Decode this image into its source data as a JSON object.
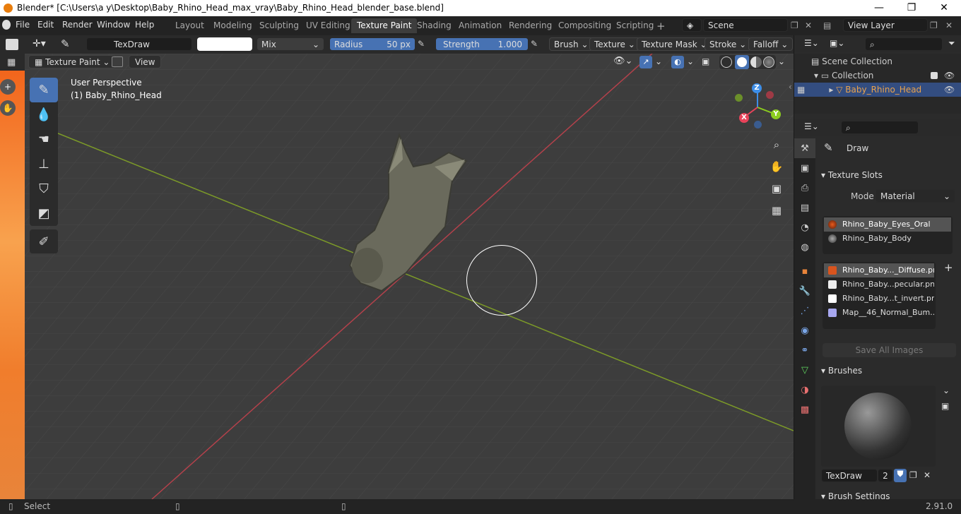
{
  "window": {
    "title": "Blender* [C:\\Users\\a y\\Desktop\\Baby_Rhino_Head_max_vray\\Baby_Rhino_Head_blender_base.blend]",
    "minimize": "—",
    "maximize": "❐",
    "close": "✕"
  },
  "menu": [
    "File",
    "Edit",
    "Render",
    "Window",
    "Help"
  ],
  "workspaces": [
    "Layout",
    "Modeling",
    "Sculpting",
    "UV Editing",
    "Texture Paint",
    "Shading",
    "Animation",
    "Rendering",
    "Compositing",
    "Scripting"
  ],
  "active_workspace": "Texture Paint",
  "scene": {
    "scene_name": "Scene",
    "view_layer": "View Layer"
  },
  "tool_header": {
    "brush_name": "TexDraw",
    "blend_mode": "Mix",
    "radius_label": "Radius",
    "radius_value": "50 px",
    "strength_label": "Strength",
    "strength_value": "1.000",
    "strength_fraction": 1.0,
    "menus": [
      "Brush",
      "Texture",
      "Texture Mask",
      "Stroke",
      "Falloff"
    ]
  },
  "viewport_header": {
    "mode": "Texture Paint",
    "view": "View"
  },
  "viewport": {
    "perspective": "User Perspective",
    "object": "(1) Baby_Rhino_Head"
  },
  "gizmo": {
    "x": "X",
    "y": "Y",
    "z": "Z"
  },
  "outliner": {
    "scene_collection": "Scene Collection",
    "collection": "Collection",
    "object": "Baby_Rhino_Head"
  },
  "properties": {
    "brush": "Draw",
    "texture_slots_title": "Texture Slots",
    "mode_label": "Mode",
    "mode_value": "Material",
    "materials": [
      "Rhino_Baby_Eyes_Oral",
      "Rhino_Baby_Body"
    ],
    "images": [
      "Rhino_Baby..._Diffuse.png",
      "Rhino_Baby...pecular.png",
      "Rhino_Baby...t_invert.png",
      "Map__46_Normal_Bum..."
    ],
    "save_all": "Save All Images",
    "brushes_title": "Brushes",
    "brush_datablock": "TexDraw",
    "brush_users": "2",
    "brush_settings_title": "Brush Settings"
  },
  "status": {
    "left": "Select",
    "version": "2.91.0"
  },
  "colors": {
    "accent": "#4772b3",
    "x_axis": "#e8435a",
    "y_axis": "#8ccd1f",
    "z_axis": "#3d8ee8"
  }
}
